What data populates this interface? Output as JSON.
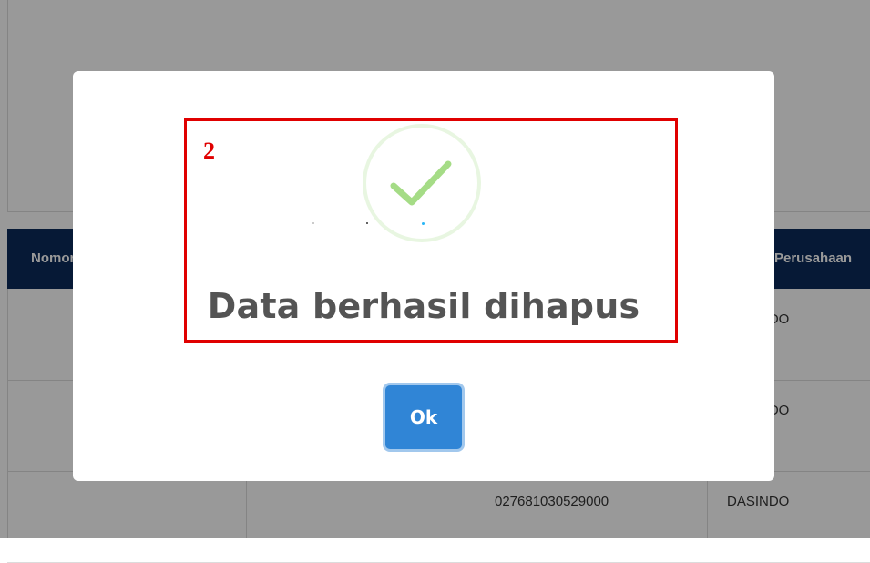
{
  "background_table": {
    "headers": {
      "nomor": "Nomor",
      "perusahaan": "Perusahaan"
    },
    "rows": [
      {
        "npwp": "",
        "perusahaan": "DASINDO"
      },
      {
        "npwp": "",
        "perusahaan": "DASINDO"
      },
      {
        "npwp": "027681030529000",
        "perusahaan": "DASINDO"
      }
    ]
  },
  "dialog": {
    "annotation_number": "2",
    "title": "Data berhasil dihapus",
    "ok_label": "Ok",
    "icon": "success-check-icon"
  },
  "colors": {
    "overlay": "rgba(0,0,0,0.40)",
    "header_bg": "#0b2b5a",
    "check": "#a5dc86",
    "ok_button": "#3085d6",
    "annotation": "#e00000"
  }
}
